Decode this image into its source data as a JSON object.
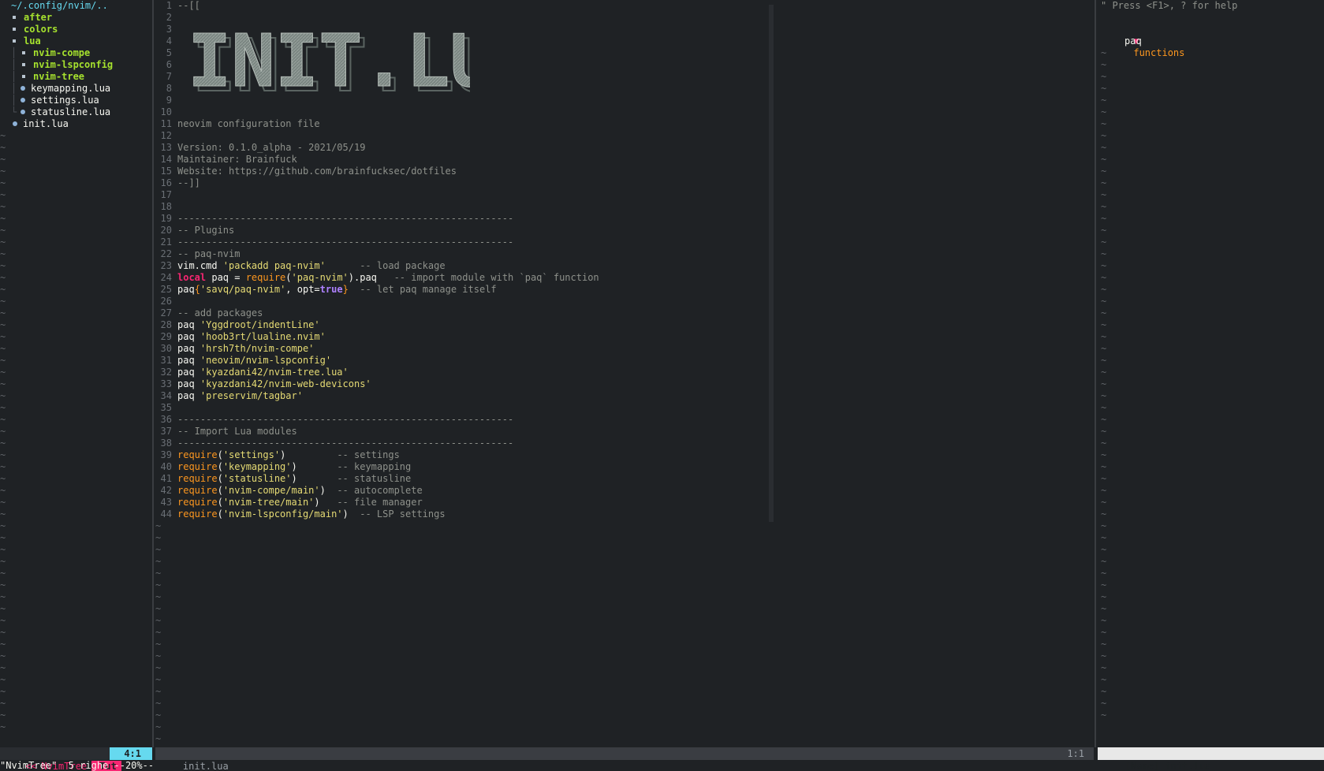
{
  "tree": {
    "header": "~/.config/nvim/..",
    "items": [
      {
        "label": "after",
        "type": "dir",
        "depth": 0
      },
      {
        "label": "colors",
        "type": "dir",
        "depth": 0
      },
      {
        "label": "lua",
        "type": "dir-open",
        "depth": 0
      },
      {
        "label": "nvim-compe",
        "type": "dir",
        "depth": 1
      },
      {
        "label": "nvim-lspconfig",
        "type": "dir",
        "depth": 1
      },
      {
        "label": "nvim-tree",
        "type": "dir",
        "depth": 1
      },
      {
        "label": "keymapping.lua",
        "type": "file",
        "depth": 1
      },
      {
        "label": "settings.lua",
        "type": "file",
        "depth": 1
      },
      {
        "label": "statusline.lua",
        "type": "file",
        "depth": 1
      },
      {
        "label": "init.lua",
        "type": "file",
        "depth": 0
      }
    ]
  },
  "editor": {
    "banner": "INIT.LUA",
    "lines": [
      {
        "n": "1",
        "parts": [
          {
            "t": "--[[",
            "c": "comment"
          }
        ]
      },
      {
        "n": "2",
        "parts": []
      },
      {
        "n": "3",
        "parts": []
      },
      {
        "n": "4",
        "parts": []
      },
      {
        "n": "5",
        "parts": []
      },
      {
        "n": "6",
        "parts": []
      },
      {
        "n": "7",
        "parts": []
      },
      {
        "n": "8",
        "parts": []
      },
      {
        "n": "9",
        "parts": []
      },
      {
        "n": "10",
        "parts": []
      },
      {
        "n": "11",
        "parts": [
          {
            "t": "neovim configuration file",
            "c": "comment"
          }
        ]
      },
      {
        "n": "12",
        "parts": []
      },
      {
        "n": "13",
        "parts": [
          {
            "t": "Version: 0.1.0_alpha - 2021/05/19",
            "c": "comment"
          }
        ]
      },
      {
        "n": "14",
        "parts": [
          {
            "t": "Maintainer: Brainfuck",
            "c": "comment"
          }
        ]
      },
      {
        "n": "15",
        "parts": [
          {
            "t": "Website: https://github.com/brainfucksec/dotfiles",
            "c": "comment"
          }
        ]
      },
      {
        "n": "16",
        "parts": [
          {
            "t": "--]]",
            "c": "comment"
          }
        ]
      },
      {
        "n": "17",
        "parts": []
      },
      {
        "n": "18",
        "parts": []
      },
      {
        "n": "19",
        "parts": [
          {
            "t": "-----------------------------------------------------------",
            "c": "comment"
          }
        ]
      },
      {
        "n": "20",
        "parts": [
          {
            "t": "-- Plugins",
            "c": "comment"
          }
        ]
      },
      {
        "n": "21",
        "parts": [
          {
            "t": "-----------------------------------------------------------",
            "c": "comment"
          }
        ]
      },
      {
        "n": "22",
        "parts": [
          {
            "t": "-- paq-nvim",
            "c": "comment"
          }
        ]
      },
      {
        "n": "23",
        "parts": [
          {
            "t": "vim.cmd ",
            "c": "plain"
          },
          {
            "t": "'packadd paq-nvim'",
            "c": "string"
          },
          {
            "t": "      -- load package",
            "c": "comment"
          }
        ]
      },
      {
        "n": "24",
        "parts": [
          {
            "t": "local",
            "c": "keyword"
          },
          {
            "t": " paq = ",
            "c": "plain"
          },
          {
            "t": "require",
            "c": "func"
          },
          {
            "t": "(",
            "c": "plain"
          },
          {
            "t": "'paq-nvim'",
            "c": "string"
          },
          {
            "t": ").paq",
            "c": "plain"
          },
          {
            "t": "   -- import module with `paq` function",
            "c": "comment"
          }
        ]
      },
      {
        "n": "25",
        "parts": [
          {
            "t": "paq",
            "c": "plain"
          },
          {
            "t": "{",
            "c": "func"
          },
          {
            "t": "'savq/paq-nvim'",
            "c": "string"
          },
          {
            "t": ", opt=",
            "c": "plain"
          },
          {
            "t": "true",
            "c": "bool"
          },
          {
            "t": "}",
            "c": "func"
          },
          {
            "t": "  -- let paq manage itself",
            "c": "comment"
          }
        ]
      },
      {
        "n": "26",
        "parts": []
      },
      {
        "n": "27",
        "parts": [
          {
            "t": "-- add packages",
            "c": "comment"
          }
        ]
      },
      {
        "n": "28",
        "parts": [
          {
            "t": "paq ",
            "c": "plain"
          },
          {
            "t": "'Yggdroot/indentLine'",
            "c": "string"
          }
        ]
      },
      {
        "n": "29",
        "parts": [
          {
            "t": "paq ",
            "c": "plain"
          },
          {
            "t": "'hoob3rt/lualine.nvim'",
            "c": "string"
          }
        ]
      },
      {
        "n": "30",
        "parts": [
          {
            "t": "paq ",
            "c": "plain"
          },
          {
            "t": "'hrsh7th/nvim-compe'",
            "c": "string"
          }
        ]
      },
      {
        "n": "31",
        "parts": [
          {
            "t": "paq ",
            "c": "plain"
          },
          {
            "t": "'neovim/nvim-lspconfig'",
            "c": "string"
          }
        ]
      },
      {
        "n": "32",
        "parts": [
          {
            "t": "paq ",
            "c": "plain"
          },
          {
            "t": "'kyazdani42/nvim-tree.lua'",
            "c": "string"
          }
        ]
      },
      {
        "n": "33",
        "parts": [
          {
            "t": "paq ",
            "c": "plain"
          },
          {
            "t": "'kyazdani42/nvim-web-devicons'",
            "c": "string"
          }
        ]
      },
      {
        "n": "34",
        "parts": [
          {
            "t": "paq ",
            "c": "plain"
          },
          {
            "t": "'preservim/tagbar'",
            "c": "string"
          }
        ]
      },
      {
        "n": "35",
        "parts": []
      },
      {
        "n": "36",
        "parts": [
          {
            "t": "-----------------------------------------------------------",
            "c": "comment"
          }
        ]
      },
      {
        "n": "37",
        "parts": [
          {
            "t": "-- Import Lua modules",
            "c": "comment"
          }
        ]
      },
      {
        "n": "38",
        "parts": [
          {
            "t": "-----------------------------------------------------------",
            "c": "comment"
          }
        ]
      },
      {
        "n": "39",
        "parts": [
          {
            "t": "require",
            "c": "func"
          },
          {
            "t": "(",
            "c": "plain"
          },
          {
            "t": "'settings'",
            "c": "string"
          },
          {
            "t": ")",
            "c": "plain"
          },
          {
            "t": "         -- settings",
            "c": "comment"
          }
        ]
      },
      {
        "n": "40",
        "parts": [
          {
            "t": "require",
            "c": "func"
          },
          {
            "t": "(",
            "c": "plain"
          },
          {
            "t": "'keymapping'",
            "c": "string"
          },
          {
            "t": ")",
            "c": "plain"
          },
          {
            "t": "       -- keymapping",
            "c": "comment"
          }
        ]
      },
      {
        "n": "41",
        "parts": [
          {
            "t": "require",
            "c": "func"
          },
          {
            "t": "(",
            "c": "plain"
          },
          {
            "t": "'statusline'",
            "c": "string"
          },
          {
            "t": ")",
            "c": "plain"
          },
          {
            "t": "       -- statusline",
            "c": "comment"
          }
        ]
      },
      {
        "n": "42",
        "parts": [
          {
            "t": "require",
            "c": "func"
          },
          {
            "t": "(",
            "c": "plain"
          },
          {
            "t": "'nvim-compe/main'",
            "c": "string"
          },
          {
            "t": ")",
            "c": "plain"
          },
          {
            "t": "  -- autocomplete",
            "c": "comment"
          }
        ]
      },
      {
        "n": "43",
        "parts": [
          {
            "t": "require",
            "c": "func"
          },
          {
            "t": "(",
            "c": "plain"
          },
          {
            "t": "'nvim-tree/main'",
            "c": "string"
          },
          {
            "t": ")",
            "c": "plain"
          },
          {
            "t": "   -- file manager",
            "c": "comment"
          }
        ]
      },
      {
        "n": "44",
        "parts": [
          {
            "t": "require",
            "c": "func"
          },
          {
            "t": "(",
            "c": "plain"
          },
          {
            "t": "'nvim-lspconfig/main'",
            "c": "string"
          },
          {
            "t": ")",
            "c": "plain"
          },
          {
            "t": "  -- LSP settings",
            "c": "comment"
          }
        ]
      }
    ]
  },
  "tagbar": {
    "help": "\" Press <F1>, ? for help",
    "kind_arrow": "▼",
    "kind": "functions",
    "items": [
      "paq"
    ]
  },
  "status": {
    "tree_arrow": "<<",
    "tree_name": "NvimTree",
    "tree_mode": "Tut",
    "tree_pos": "4:1",
    "editor_file": "init.lua",
    "editor_pos": "1:1",
    "tagbar_label": "[Name] init.lua"
  },
  "cmdline": "\"NvimTree\"  5 righe --20%--",
  "tilde": "~"
}
